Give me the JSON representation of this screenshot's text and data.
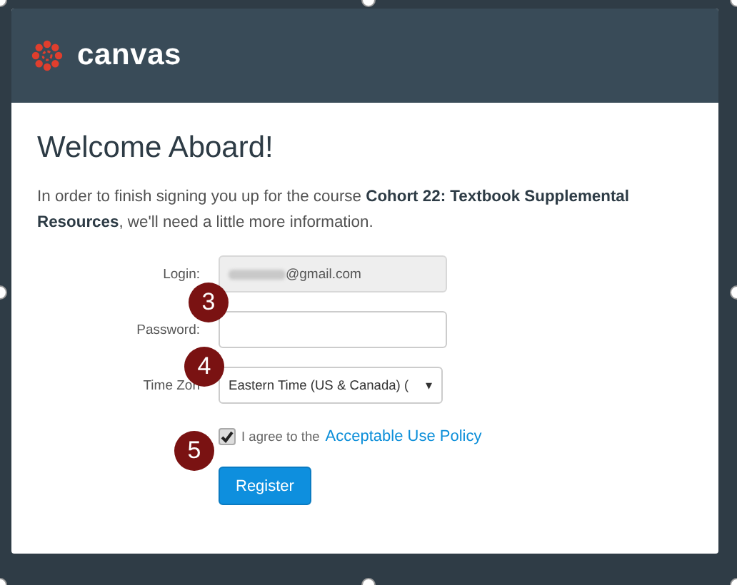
{
  "header": {
    "logo_text": "canvas"
  },
  "title": "Welcome Aboard!",
  "intro": "In order to finish signing you up for the course **Cohort 22: Textbook Supplemental Resources**, we'll need a little more information.",
  "fields": [
    {
      "kind": "text",
      "label": "Login:",
      "value": "@gmail.com",
      "disabled": true
    },
    {
      "kind": "password",
      "label": "Password:",
      "disabled": false
    },
    {
      "kind": "select",
      "label": "Time Zon",
      "value": "Eastern Time (US & Canada) (",
      "caret": "▾",
      "disabled": false
    }
  ],
  "agree": {
    "checked": true,
    "text": "I agree to the",
    "link": "Acceptable Use Policy"
  },
  "button": "Register",
  "callouts": [
    "3",
    "4",
    "5"
  ]
}
